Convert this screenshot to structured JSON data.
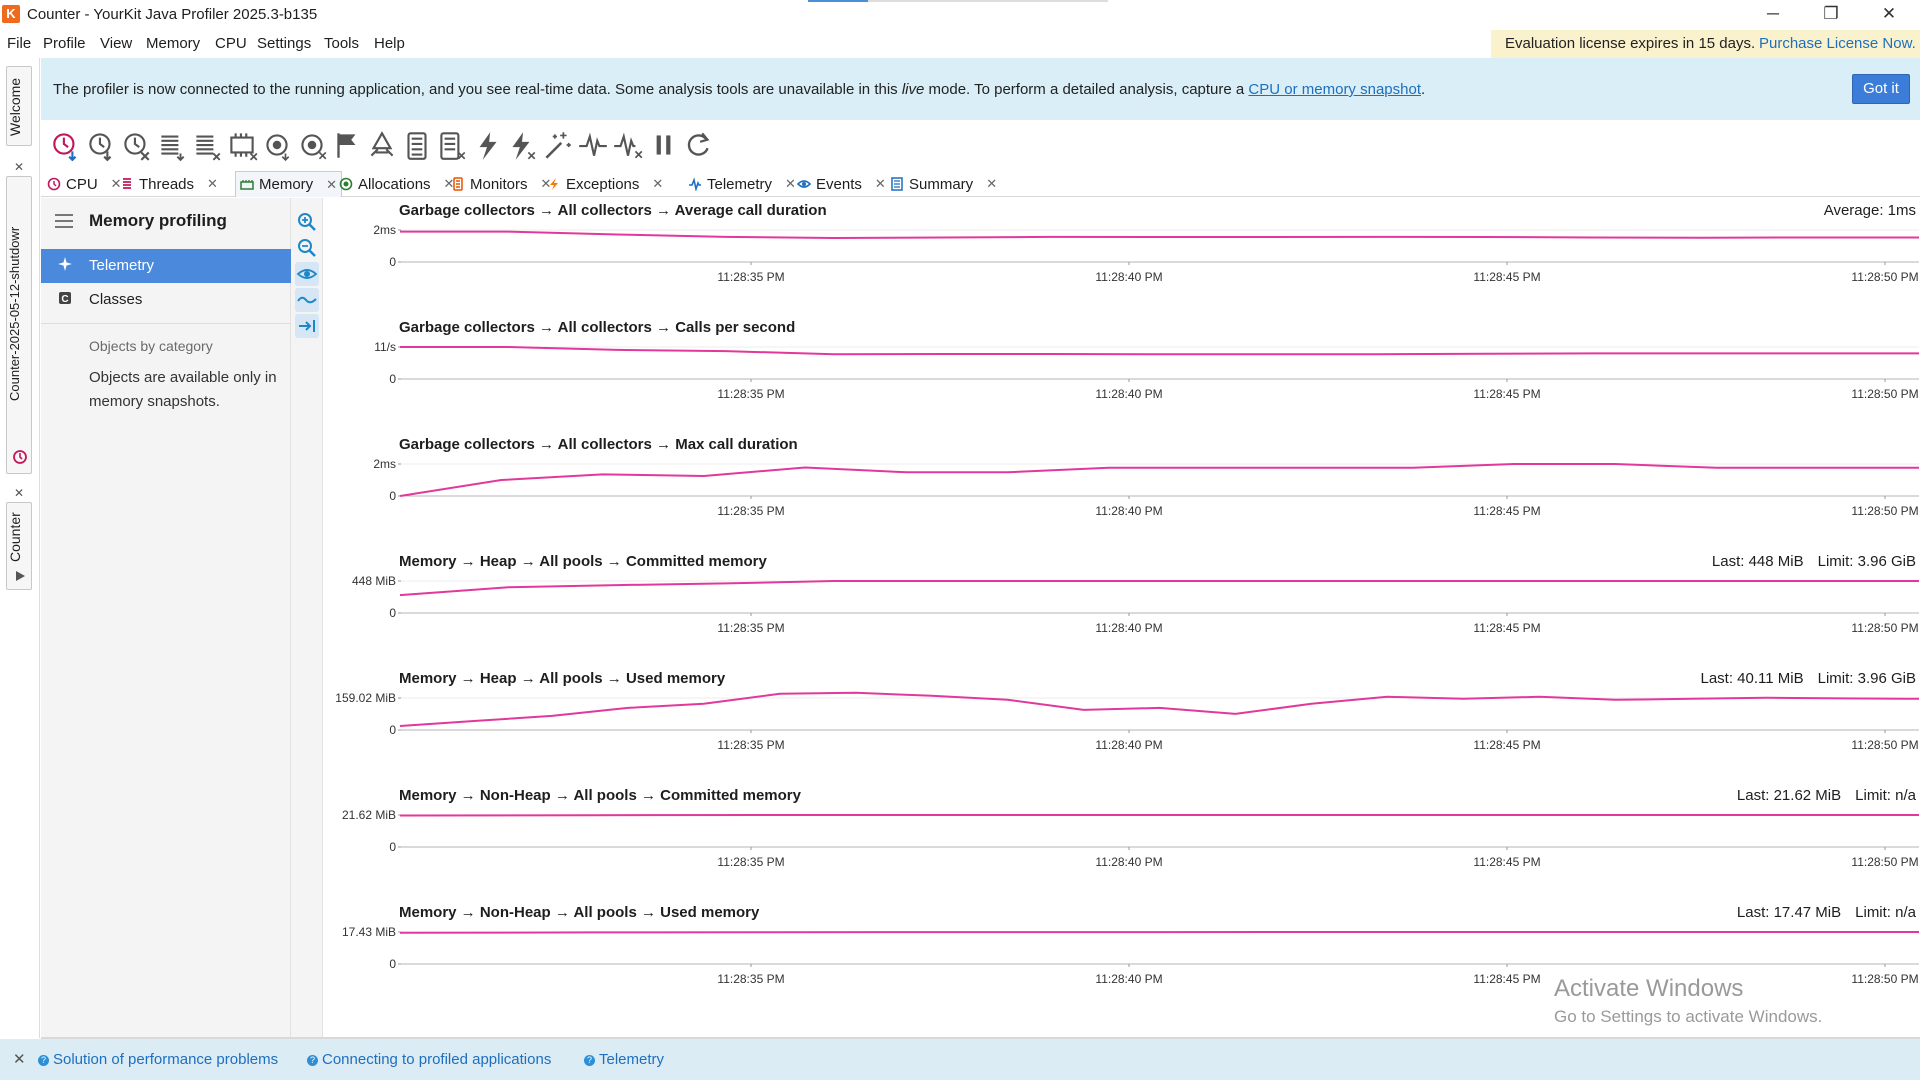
{
  "window": {
    "title": "Counter - YourKit Java Profiler 2025.3-b135",
    "logo_letter": "K",
    "minimize_glyph": "─",
    "restore_glyph": "❐",
    "close_glyph": "✕"
  },
  "menu": {
    "items": [
      "File",
      "Profile",
      "View",
      "Memory",
      "CPU",
      "Settings",
      "Tools",
      "Help"
    ]
  },
  "license": {
    "text": "Evaluation license expires in 15 days.",
    "link": "Purchase License Now."
  },
  "side_tabs": [
    {
      "label": "Welcome",
      "icon": ""
    },
    {
      "label": "Counter-2025-05-12-shutdowr",
      "icon": "profiler-icon"
    },
    {
      "label": "Counter",
      "icon": "play-icon"
    }
  ],
  "notification": {
    "text_before": "The profiler is now connected to the running application, and you see real-time data. Some analysis tools are unavailable in this ",
    "text_italic": "live",
    "text_middle": " mode. To perform a detailed analysis, capture a ",
    "link": "CPU or memory snapshot",
    "text_after": ".",
    "button": "Got it"
  },
  "toolbar": {
    "tools": [
      "cpu-sampling-start-icon",
      "cpu-tracing-icon",
      "cpu-stop-icon",
      "threads-icon",
      "threads-clear-icon",
      "memory-snapshot-icon",
      "allocation-record-icon",
      "allocation-stop-icon",
      "flag-icon",
      "gc-icon",
      "monitors-icon",
      "monitors-clear-icon",
      "exceptions-icon",
      "exceptions-clear-icon",
      "magic-icon",
      "telemetry-icon",
      "telemetry-clear-icon",
      "pause-icon",
      "refresh-icon"
    ]
  },
  "tabs": [
    {
      "label": "CPU",
      "icon": "cpu-icon",
      "color": "#c2185b"
    },
    {
      "label": "Threads",
      "icon": "threads-icon",
      "color": "#c2185b"
    },
    {
      "label": "Memory",
      "icon": "memory-icon",
      "color": "#2e7d32",
      "active": true
    },
    {
      "label": "Allocations",
      "icon": "allocations-icon",
      "color": "#2e7d32"
    },
    {
      "label": "Monitors",
      "icon": "monitors-icon",
      "color": "#e65100"
    },
    {
      "label": "Exceptions",
      "icon": "exceptions-icon",
      "color": "#f57c00"
    },
    {
      "label": "Telemetry",
      "icon": "telemetry-icon",
      "color": "#1e6fbf"
    },
    {
      "label": "Events",
      "icon": "events-icon",
      "color": "#1e6fbf"
    },
    {
      "label": "Summary",
      "icon": "summary-icon",
      "color": "#1e6fbf"
    }
  ],
  "sidebar": {
    "title": "Memory profiling",
    "items": [
      {
        "label": "Telemetry",
        "icon": "telemetry-icon",
        "selected": true
      },
      {
        "label": "Classes",
        "icon": "classes-icon",
        "selected": false
      }
    ],
    "category_title": "Objects by category",
    "category_desc": "Objects are available only in memory snapshots."
  },
  "graph_tools": [
    "zoom-in-icon",
    "zoom-out-icon",
    "eye-icon",
    "wave-icon",
    "jump-to-end-icon"
  ],
  "colors": {
    "series": "#e0399b",
    "series_dark": "#b0308c",
    "accent": "#3b7dd8",
    "selected": "#4b89dc"
  },
  "chart_data": [
    {
      "type": "line",
      "title": "Garbage collectors → All collectors → Average call duration",
      "right_info": [
        "Average: 1ms"
      ],
      "y_ticks": [
        "2ms",
        "0"
      ],
      "ylim": [
        0,
        2
      ],
      "x_ticks": [
        "11:28:35 PM",
        "11:28:40 PM",
        "11:28:45 PM",
        "11:28:50 PM"
      ],
      "series": [
        {
          "values": [
            1.9,
            1.9,
            1.72,
            1.57,
            1.5,
            1.53,
            1.57,
            1.56,
            1.56,
            1.57,
            1.56,
            1.53,
            1.52,
            1.53,
            1.53
          ]
        }
      ]
    },
    {
      "type": "line",
      "title": "Garbage collectors → All collectors → Calls per second",
      "right_info": [],
      "y_ticks": [
        "11/s",
        "0"
      ],
      "ylim": [
        0,
        11
      ],
      "x_ticks": [
        "11:28:35 PM",
        "11:28:40 PM",
        "11:28:45 PM",
        "11:28:50 PM"
      ],
      "series": [
        {
          "values": [
            11,
            11,
            10,
            9.6,
            8.5,
            8.6,
            8.6,
            8.5,
            8.5,
            8.5,
            8.7,
            8.8,
            8.8,
            8.8,
            8.8
          ]
        }
      ]
    },
    {
      "type": "line",
      "title": "Garbage collectors → All collectors → Max call duration",
      "right_info": [],
      "y_ticks": [
        "2ms",
        "0"
      ],
      "ylim": [
        0,
        2
      ],
      "x_ticks": [
        "11:28:35 PM",
        "11:28:40 PM",
        "11:28:45 PM",
        "11:28:50 PM"
      ],
      "series": [
        {
          "values": [
            0,
            1.0,
            1.35,
            1.25,
            1.78,
            1.48,
            1.48,
            1.76,
            1.76,
            1.76,
            1.76,
            2.0,
            2.0,
            1.76,
            1.76,
            1.76
          ]
        }
      ]
    },
    {
      "type": "line",
      "title": "Memory → Heap → All pools → Committed memory",
      "right_info": [
        "Last: 448 MiB",
        "Limit: 3.96 GiB"
      ],
      "y_ticks": [
        "448 MiB",
        "0"
      ],
      "ylim": [
        0,
        448
      ],
      "x_ticks": [
        "11:28:35 PM",
        "11:28:40 PM",
        "11:28:45 PM",
        "11:28:50 PM"
      ],
      "series": [
        {
          "values": [
            250,
            360,
            390,
            415,
            448,
            448,
            448,
            448,
            448,
            448,
            448,
            448,
            448,
            448,
            448
          ]
        }
      ]
    },
    {
      "type": "line",
      "title": "Memory → Heap → All pools → Used memory",
      "right_info": [
        "Last: 40.11 MiB",
        "Limit: 3.96 GiB"
      ],
      "y_ticks": [
        "159.02 MiB",
        "0"
      ],
      "ylim": [
        0,
        159.02
      ],
      "x_ticks": [
        "11:28:35 PM",
        "11:28:40 PM",
        "11:28:45 PM",
        "11:28:50 PM"
      ],
      "series": [
        {
          "values": [
            20,
            45,
            70,
            110,
            130,
            180,
            185,
            170,
            150,
            100,
            110,
            80,
            130,
            165,
            155,
            165,
            150,
            155,
            160,
            157,
            155
          ]
        }
      ]
    },
    {
      "type": "line",
      "title": "Memory → Non-Heap → All pools → Committed memory",
      "right_info": [
        "Last: 21.62 MiB",
        "Limit: n/a"
      ],
      "y_ticks": [
        "21.62 MiB",
        "0"
      ],
      "ylim": [
        0,
        21.62
      ],
      "x_ticks": [
        "11:28:35 PM",
        "11:28:40 PM",
        "11:28:45 PM",
        "11:28:50 PM"
      ],
      "series": [
        {
          "values": [
            21.3,
            21.5,
            21.6,
            21.62,
            21.62,
            21.62,
            21.62,
            21.62,
            21.62
          ]
        }
      ]
    },
    {
      "type": "line",
      "title": "Memory → Non-Heap → All pools → Used memory",
      "right_info": [
        "Last: 17.47 MiB",
        "Limit: n/a"
      ],
      "y_ticks": [
        "17.43 MiB",
        "0"
      ],
      "ylim": [
        0,
        17.43
      ],
      "x_ticks": [
        "11:28:35 PM",
        "11:28:40 PM",
        "11:28:45 PM",
        "11:28:50 PM"
      ],
      "series": [
        {
          "values": [
            17.0,
            17.2,
            17.3,
            17.35,
            17.4,
            17.42,
            17.43,
            17.43,
            17.43
          ]
        }
      ]
    }
  ],
  "watermark": {
    "line1": "Activate Windows",
    "line2": "Go to Settings to activate Windows."
  },
  "statusbar": {
    "close_glyph": "✕",
    "links": [
      "Solution of performance problems",
      "Connecting to profiled applications",
      "Telemetry"
    ]
  }
}
